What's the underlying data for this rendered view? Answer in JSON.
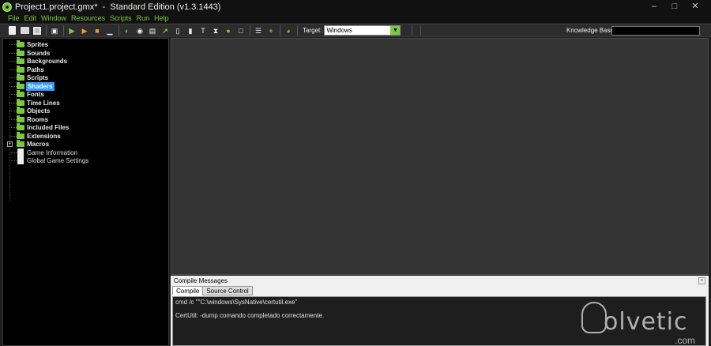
{
  "window": {
    "title": "Project1.project.gmx*  -  Standard Edition (v1.3.1443)",
    "controls": [
      "–",
      "□",
      "✕"
    ]
  },
  "menu": [
    "File",
    "Edit",
    "Window",
    "Resources",
    "Scripts",
    "Run",
    "Help"
  ],
  "toolbar": {
    "target_label": "Target:",
    "target_value": "Windows",
    "knowledge_base_label": "Knowledge Base:",
    "knowledge_base_value": "",
    "icons": [
      "new-icon",
      "open-icon",
      "save-icon",
      "export-icon",
      "run-icon",
      "debug-icon",
      "stop-icon",
      "clean-icon",
      "sprite-icon",
      "sound-icon",
      "background-icon",
      "path-icon",
      "script-icon",
      "shader-icon",
      "font-icon",
      "timeline-icon",
      "object-icon",
      "room-icon",
      "included-file-icon",
      "extension-icon",
      "game-info-icon",
      "global-settings-icon"
    ],
    "accent_color": "#7ac943"
  },
  "tree": {
    "items": [
      {
        "label": "Sprites",
        "type": "folder",
        "selected": false
      },
      {
        "label": "Sounds",
        "type": "folder",
        "selected": false
      },
      {
        "label": "Backgrounds",
        "type": "folder",
        "selected": false
      },
      {
        "label": "Paths",
        "type": "folder",
        "selected": false
      },
      {
        "label": "Scripts",
        "type": "folder",
        "selected": false
      },
      {
        "label": "Shaders",
        "type": "folder",
        "selected": true
      },
      {
        "label": "Fonts",
        "type": "folder",
        "selected": false
      },
      {
        "label": "Time Lines",
        "type": "folder",
        "selected": false
      },
      {
        "label": "Objects",
        "type": "folder",
        "selected": false
      },
      {
        "label": "Rooms",
        "type": "folder",
        "selected": false
      },
      {
        "label": "Included Files",
        "type": "folder",
        "selected": false
      },
      {
        "label": "Extensions",
        "type": "folder",
        "selected": false
      },
      {
        "label": "Macros",
        "type": "folder",
        "selected": false,
        "expandable": true
      },
      {
        "label": "Game Information",
        "type": "document",
        "selected": false
      },
      {
        "label": "Global Game Settings",
        "type": "document",
        "selected": false
      }
    ]
  },
  "compile": {
    "title": "Compile Messages",
    "tabs": [
      {
        "label": "Compile",
        "active": true
      },
      {
        "label": "Source Control",
        "active": false
      }
    ],
    "output": [
      "cmd /c \"\"C:\\windows\\SysNative\\certutil.exe\"",
      "",
      "CertUtil: -dump comando completado correctamente."
    ]
  },
  "watermark": {
    "text": "olvetic",
    "suffix": ".com"
  }
}
